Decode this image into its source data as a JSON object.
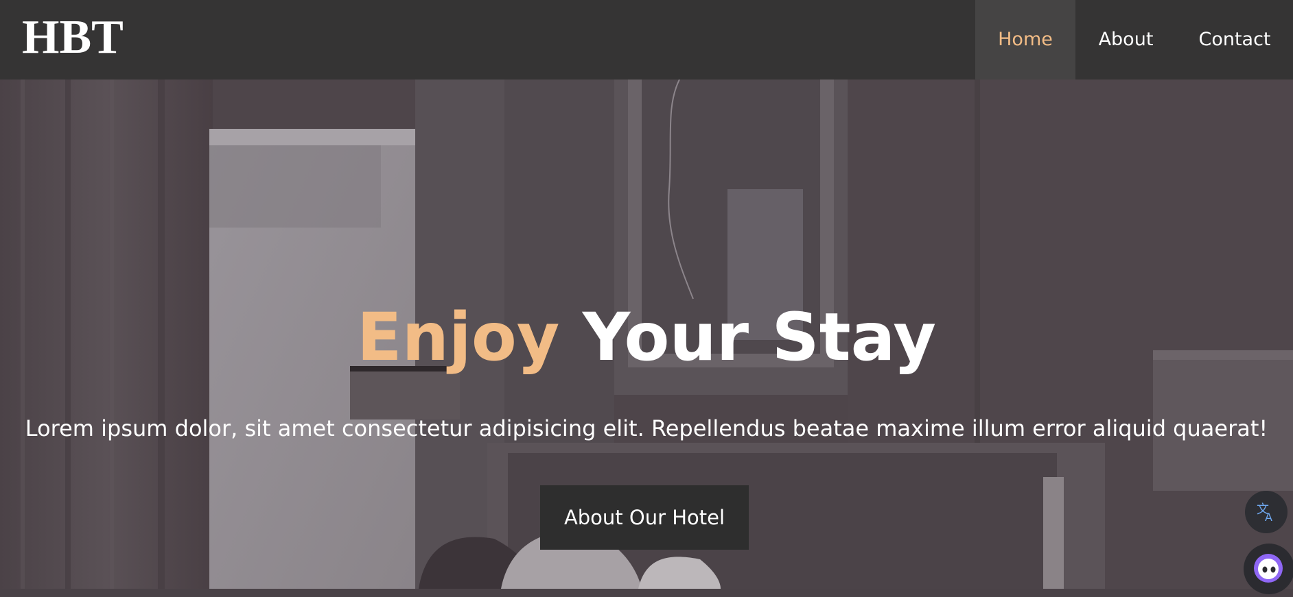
{
  "brand": {
    "logo": "HBT"
  },
  "nav": {
    "items": [
      {
        "label": "Home",
        "active": true
      },
      {
        "label": "About",
        "active": false
      },
      {
        "label": "Contact",
        "active": false
      }
    ]
  },
  "hero": {
    "title_accent": "Enjoy",
    "title_rest": "Your Stay",
    "subtitle": "Lorem ipsum dolor, sit amet consectetur adipisicing elit. Repellendus beatae maxime illum error aliquid quaerat!",
    "button_label": "About Our Hotel"
  },
  "floating": {
    "translate_icon": "translate-icon",
    "assistant_icon": "assistant-face-icon"
  },
  "colors": {
    "navbar": "#353434",
    "nav_active_bg": "#454444",
    "accent": "#f2bc86",
    "button_bg": "#2e2e2e",
    "hero_overlay": "#4d4449",
    "text": "#ffffff"
  }
}
